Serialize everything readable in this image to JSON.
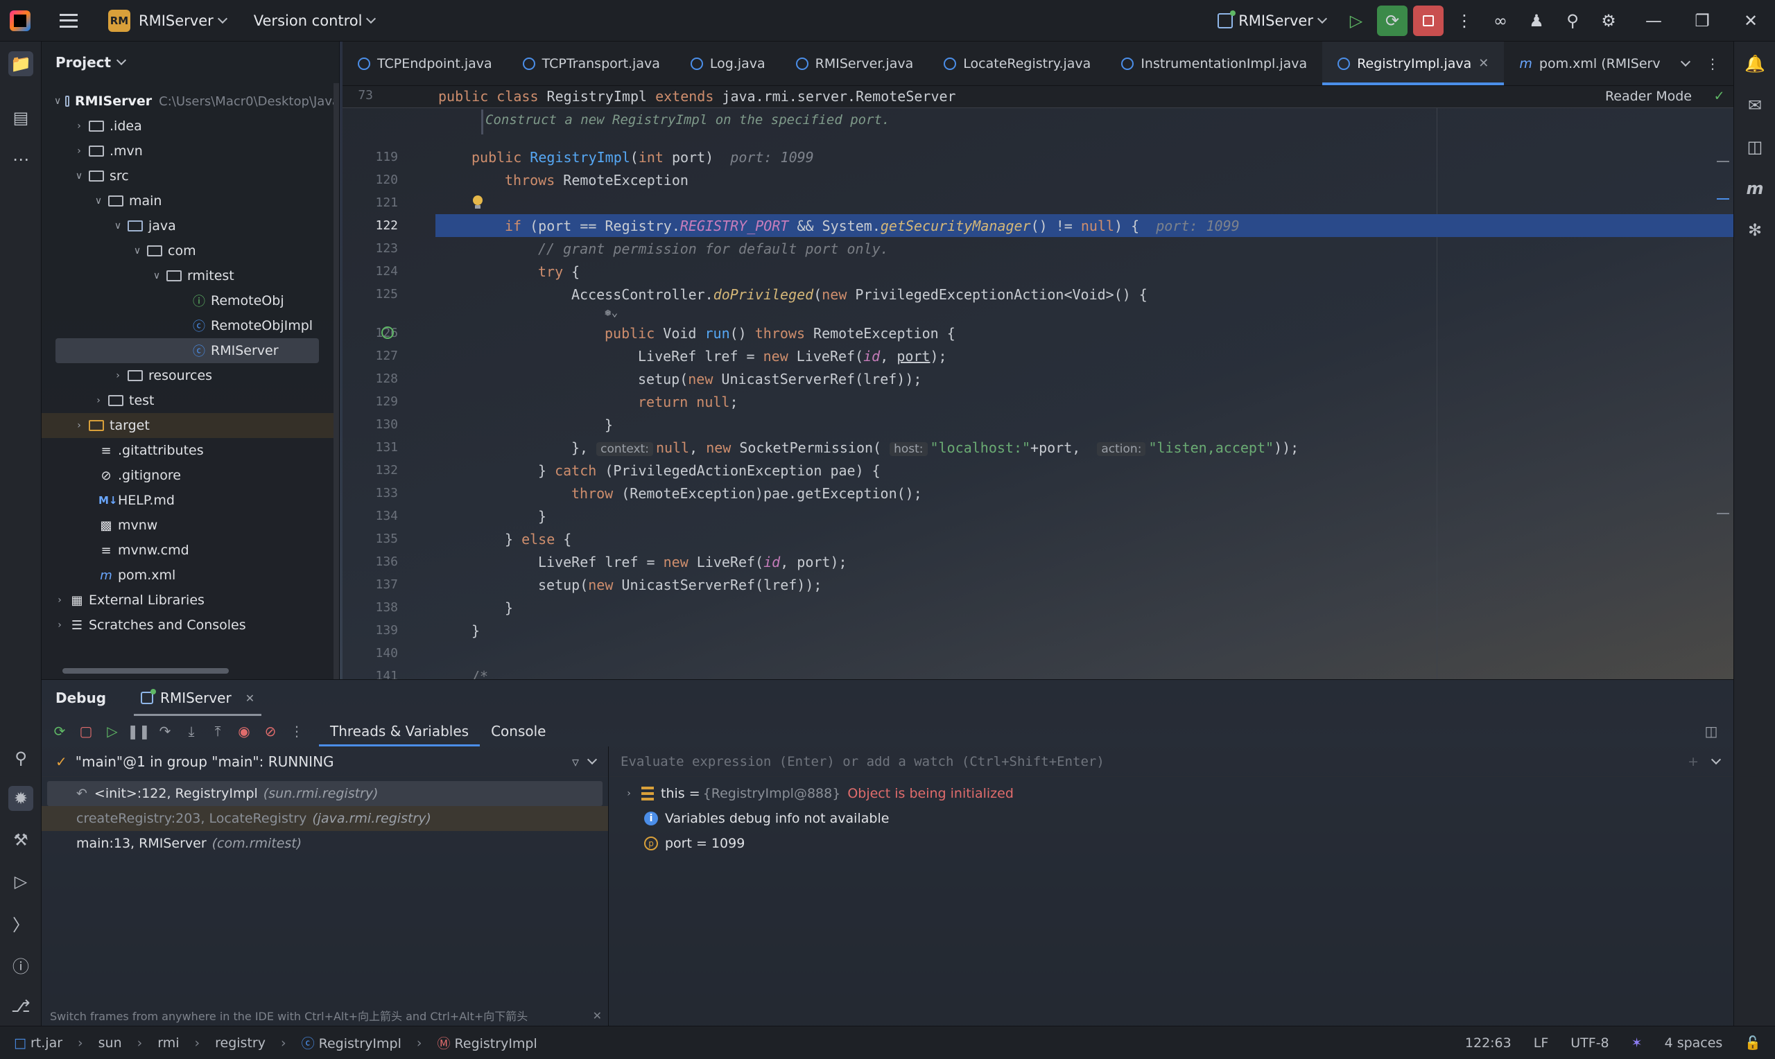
{
  "titlebar": {
    "project_badge": "RM",
    "project_name": "RMIServer",
    "vcs_label": "Version control",
    "run_config": "RMIServer"
  },
  "project_pane": {
    "title": "Project",
    "root_name": "RMIServer",
    "root_path": "C:\\Users\\Macr0\\Desktop\\Java",
    "items": [
      {
        "label": "RMIServer"
      },
      {
        "label": ".idea"
      },
      {
        "label": ".mvn"
      },
      {
        "label": "src"
      },
      {
        "label": "main"
      },
      {
        "label": "java"
      },
      {
        "label": "com"
      },
      {
        "label": "rmitest"
      },
      {
        "label": "RemoteObj"
      },
      {
        "label": "RemoteObjImpl"
      },
      {
        "label": "RMIServer"
      },
      {
        "label": "resources"
      },
      {
        "label": "test"
      },
      {
        "label": "target"
      },
      {
        "label": ".gitattributes"
      },
      {
        "label": ".gitignore"
      },
      {
        "label": "HELP.md"
      },
      {
        "label": "mvnw"
      },
      {
        "label": "mvnw.cmd"
      },
      {
        "label": "pom.xml"
      },
      {
        "label": "External Libraries"
      },
      {
        "label": "Scratches and Consoles"
      }
    ]
  },
  "tabs": [
    {
      "label": "TCPEndpoint.java"
    },
    {
      "label": "TCPTransport.java"
    },
    {
      "label": "Log.java"
    },
    {
      "label": "RMIServer.java"
    },
    {
      "label": "LocateRegistry.java"
    },
    {
      "label": "InstrumentationImpl.java"
    },
    {
      "label": "RegistryImpl.java"
    },
    {
      "label": "pom.xml (RMIServ"
    }
  ],
  "editor": {
    "sticky_line": "73",
    "reader_mode": "Reader Mode",
    "doc_comment": "Construct a new RegistryImpl on the specified port.",
    "line_numbers": [
      "119",
      "120",
      "121",
      "122",
      "123",
      "124",
      "125",
      "126",
      "127",
      "128",
      "129",
      "130",
      "131",
      "132",
      "133",
      "134",
      "135",
      "136",
      "137",
      "138",
      "139",
      "140",
      "141"
    ],
    "hint_port": "port: 1099",
    "inlay_context": "context:",
    "inlay_host": "host:",
    "inlay_action": "action:"
  },
  "debug": {
    "title": "Debug",
    "session_tab": "RMIServer",
    "subtab_threads": "Threads & Variables",
    "subtab_console": "Console",
    "thread_status": "\"main\"@1 in group \"main\": RUNNING",
    "frames": [
      {
        "method": "<init>:122, RegistryImpl",
        "pkg": "(sun.rmi.registry)"
      },
      {
        "method": "createRegistry:203, LocateRegistry",
        "pkg": "(java.rmi.registry)"
      },
      {
        "method": "main:13, RMIServer",
        "pkg": "(com.rmitest)"
      }
    ],
    "hint": "Switch frames from anywhere in the IDE with Ctrl+Alt+向上箭头 and Ctrl+Alt+向下箭头",
    "eval_placeholder": "Evaluate expression (Enter) or add a watch (Ctrl+Shift+Enter)",
    "vars": {
      "this_name": "this =",
      "this_value": "{RegistryImpl@888}",
      "this_note": "Object is being initialized",
      "info": "Variables debug info not available",
      "port": "port = 1099"
    }
  },
  "status": {
    "crumbs": [
      "rt.jar",
      "sun",
      "rmi",
      "registry",
      "RegistryImpl",
      "RegistryImpl"
    ],
    "position": "122:63",
    "line_sep": "LF",
    "encoding": "UTF-8",
    "indent": "4 spaces"
  }
}
